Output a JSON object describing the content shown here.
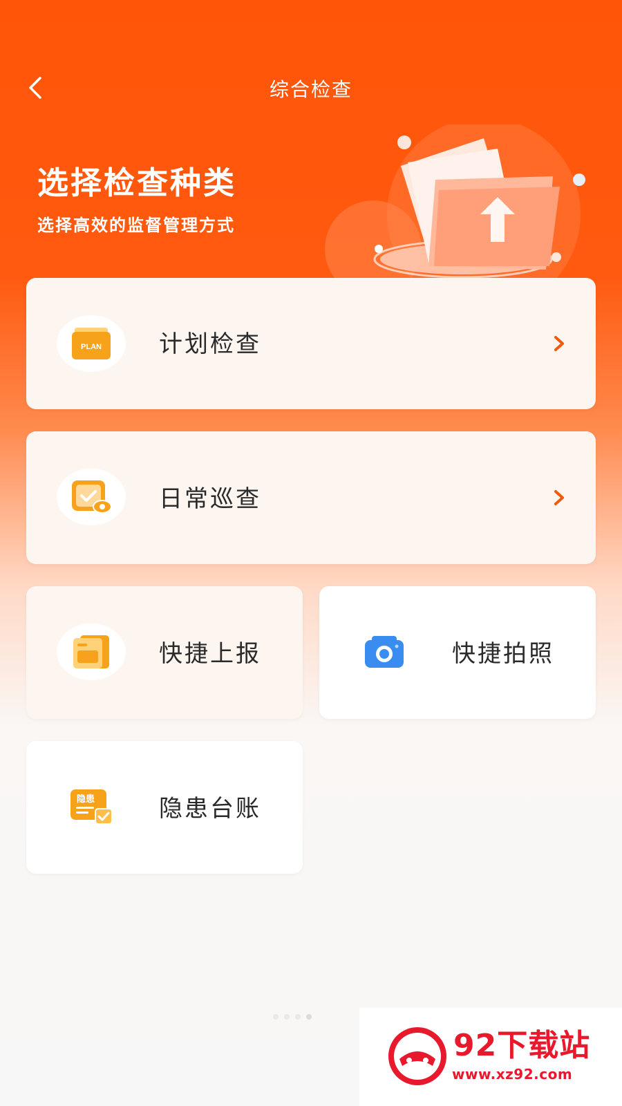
{
  "header": {
    "title": "综合检查"
  },
  "hero": {
    "title": "选择检查种类",
    "subtitle": "选择高效的监督管理方式"
  },
  "cards": {
    "plan": {
      "label": "计划检查",
      "icon_text": "PLAN",
      "icon": "plan-folder-icon"
    },
    "daily": {
      "label": "日常巡查",
      "icon": "inspection-eye-icon"
    },
    "quick_report": {
      "label": "快捷上报",
      "icon": "document-folder-icon"
    },
    "quick_photo": {
      "label": "快捷拍照",
      "icon": "camera-icon"
    },
    "hazard": {
      "label": "隐患台账",
      "icon_text": "隐患",
      "icon": "hazard-ledger-icon"
    }
  },
  "watermark": {
    "text": "92下载站",
    "url": "www.xz92.com"
  },
  "colors": {
    "primary": "#ff5508",
    "icon_orange": "#f7a21b",
    "camera_blue": "#3a8df0",
    "chevron": "#f05a0a",
    "watermark_red": "#e8192c"
  }
}
